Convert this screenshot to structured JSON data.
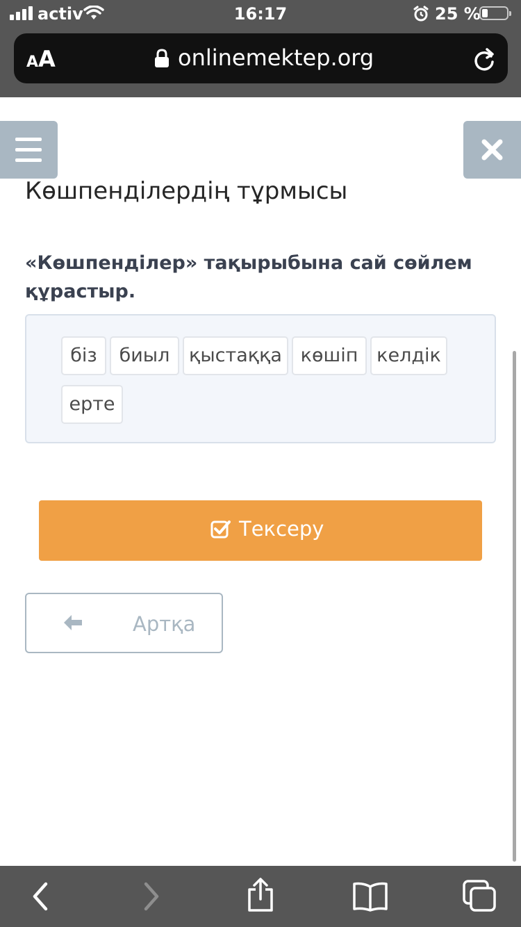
{
  "status_bar": {
    "carrier": "activ",
    "time": "16:17",
    "battery": "25 %",
    "battery_level": 0.25
  },
  "browser": {
    "text_size_label": "AA",
    "url": "onlinemektep.org"
  },
  "page": {
    "title": "Көшпенділердің тұрмысы",
    "question": "«Көшпенділер» тақырыбына сай сөйлем құрастыр.",
    "words": [
      "біз",
      "биыл",
      "қыстаққа",
      "көшіп",
      "келдік",
      "ерте"
    ],
    "check_button": "Тексеру",
    "back_button": "Артқа"
  },
  "colors": {
    "accent_orange": "#f0a045",
    "muted_slate": "#a9b7c2",
    "chrome_gray": "#565656"
  },
  "icons": {
    "menu": "hamburger-icon",
    "close": "close-icon",
    "check": "checkbox-check-icon",
    "back": "arrow-left-icon"
  }
}
